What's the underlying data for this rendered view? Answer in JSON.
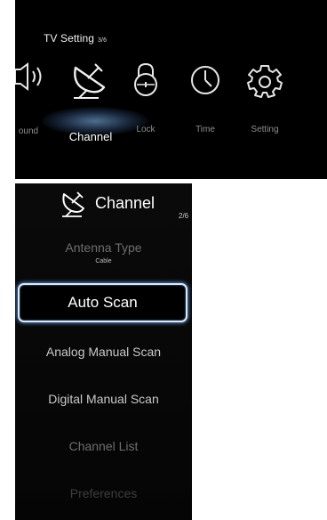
{
  "tv_setting": {
    "title": "TV Setting",
    "page": "3/6",
    "menu": [
      {
        "label": "ound",
        "icon": "speaker-icon"
      },
      {
        "label": "Channel",
        "icon": "satellite-dish-icon"
      },
      {
        "label": "Lock",
        "icon": "lock-icon"
      },
      {
        "label": "Time",
        "icon": "clock-icon"
      },
      {
        "label": "Setting",
        "icon": "gear-icon"
      }
    ]
  },
  "channel_menu": {
    "title": "Channel",
    "page": "2/6",
    "items": [
      {
        "label": "Antenna Type",
        "value": "Cable"
      },
      {
        "label": "Auto Scan"
      },
      {
        "label": "Analog Manual Scan"
      },
      {
        "label": "Digital Manual Scan"
      },
      {
        "label": "Channel List"
      },
      {
        "label": "Preferences"
      }
    ]
  },
  "colors": {
    "background": "#000000",
    "highlight_border": "#dfe8f2",
    "highlight_glow": "#4f86c6"
  }
}
